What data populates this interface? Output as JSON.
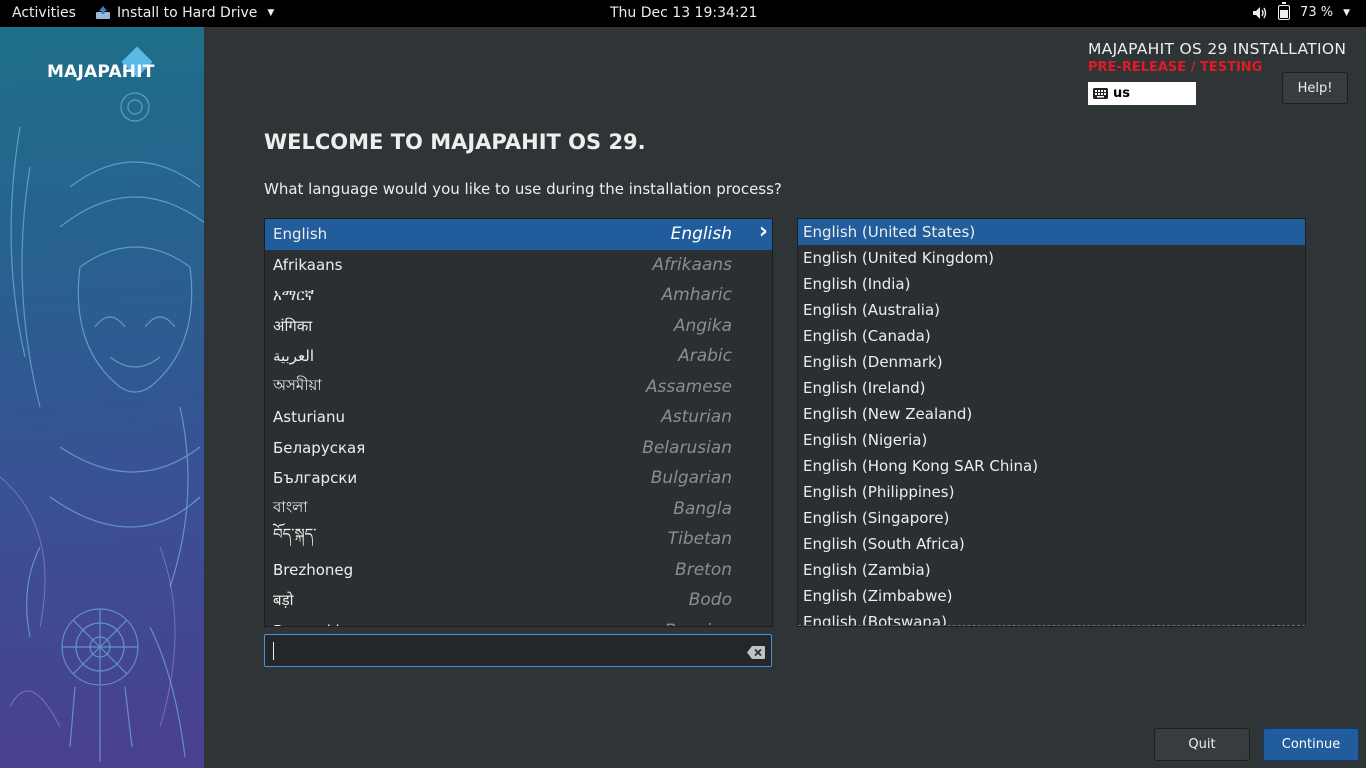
{
  "topbar": {
    "activities": "Activities",
    "app_name": "Install to Hard Drive",
    "clock": "Thu Dec 13  19:34:21",
    "battery": "73 %"
  },
  "sidebar": {
    "brand": "MAJAPAHIT"
  },
  "header": {
    "title": "MAJAPAHIT OS 29 INSTALLATION",
    "prerelease": "PRE-RELEASE / TESTING",
    "keyboard_layout": "us",
    "help_label": "Help!"
  },
  "welcome": {
    "title": "WELCOME TO MAJAPAHIT OS 29.",
    "question": "What language would you like to use during the installation process?"
  },
  "languages": [
    {
      "native": "English",
      "english": "English"
    },
    {
      "native": "Afrikaans",
      "english": "Afrikaans"
    },
    {
      "native": "አማርኛ",
      "english": "Amharic"
    },
    {
      "native": "अंगिका",
      "english": "Angika"
    },
    {
      "native": "العربية",
      "english": "Arabic"
    },
    {
      "native": "অসমীয়া",
      "english": "Assamese"
    },
    {
      "native": "Asturianu",
      "english": "Asturian"
    },
    {
      "native": "Беларуская",
      "english": "Belarusian"
    },
    {
      "native": "Български",
      "english": "Bulgarian"
    },
    {
      "native": "বাংলা",
      "english": "Bangla"
    },
    {
      "native": "བོད་སྐད་",
      "english": "Tibetan"
    },
    {
      "native": "Brezhoneg",
      "english": "Breton"
    },
    {
      "native": "बड़ो",
      "english": "Bodo"
    },
    {
      "native": "Bosanski",
      "english": "Bosnian"
    }
  ],
  "locales": [
    "English (United States)",
    "English (United Kingdom)",
    "English (India)",
    "English (Australia)",
    "English (Canada)",
    "English (Denmark)",
    "English (Ireland)",
    "English (New Zealand)",
    "English (Nigeria)",
    "English (Hong Kong SAR China)",
    "English (Philippines)",
    "English (Singapore)",
    "English (South Africa)",
    "English (Zambia)",
    "English (Zimbabwe)",
    "English (Botswana)"
  ],
  "search": {
    "value": "",
    "placeholder": ""
  },
  "buttons": {
    "quit": "Quit",
    "continue": "Continue"
  }
}
